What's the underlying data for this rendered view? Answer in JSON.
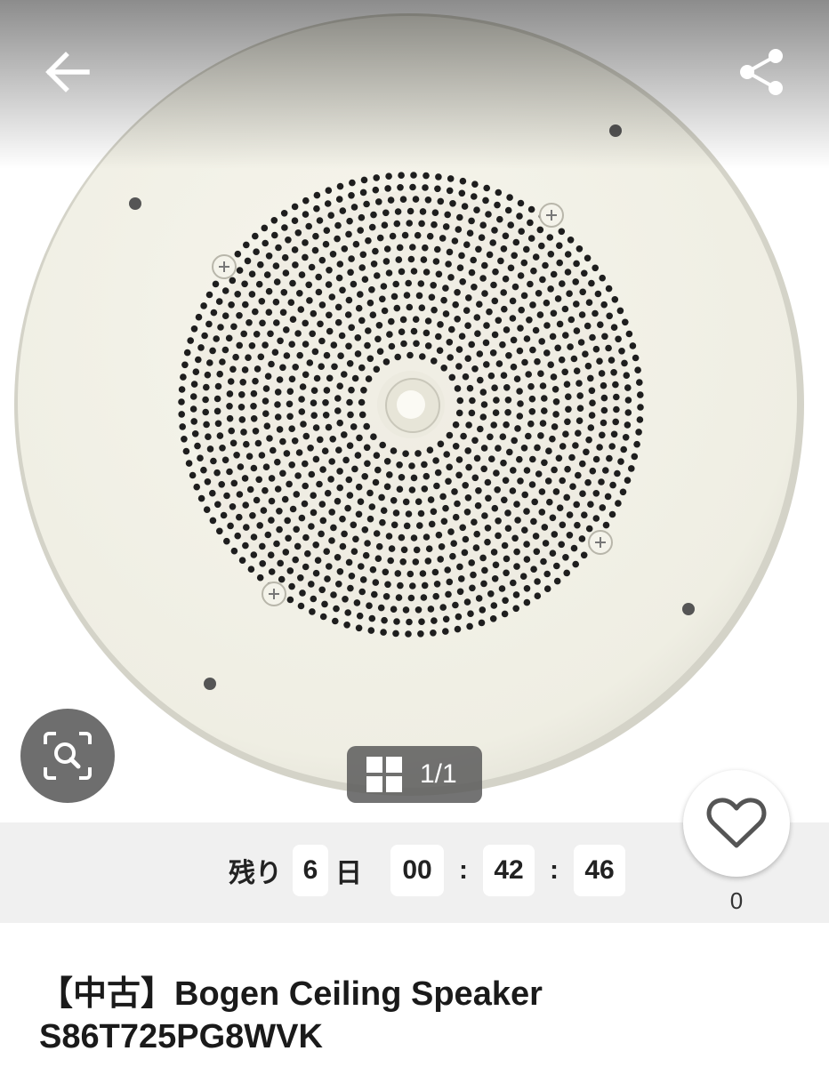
{
  "header": {
    "back_icon": "arrow-left-icon",
    "share_icon": "share-icon"
  },
  "image_viewer": {
    "zoom_icon": "image-search-icon",
    "gallery_icon": "grid-icon",
    "counter": "1/1"
  },
  "countdown": {
    "prefix": "残り",
    "days": "6",
    "day_unit": "日",
    "hours": "00",
    "minutes": "42",
    "seconds": "46",
    "separator": ":"
  },
  "favorite": {
    "icon": "heart-icon",
    "count": "0"
  },
  "product": {
    "title_line1": "【中古】Bogen Ceiling Speaker",
    "title_line2": "S86T725PG8WVK"
  },
  "colors": {
    "speaker_plate": "#f1f0e6",
    "overlay_button": "#6e6e6e",
    "countdown_bg": "#f0f0f0"
  }
}
